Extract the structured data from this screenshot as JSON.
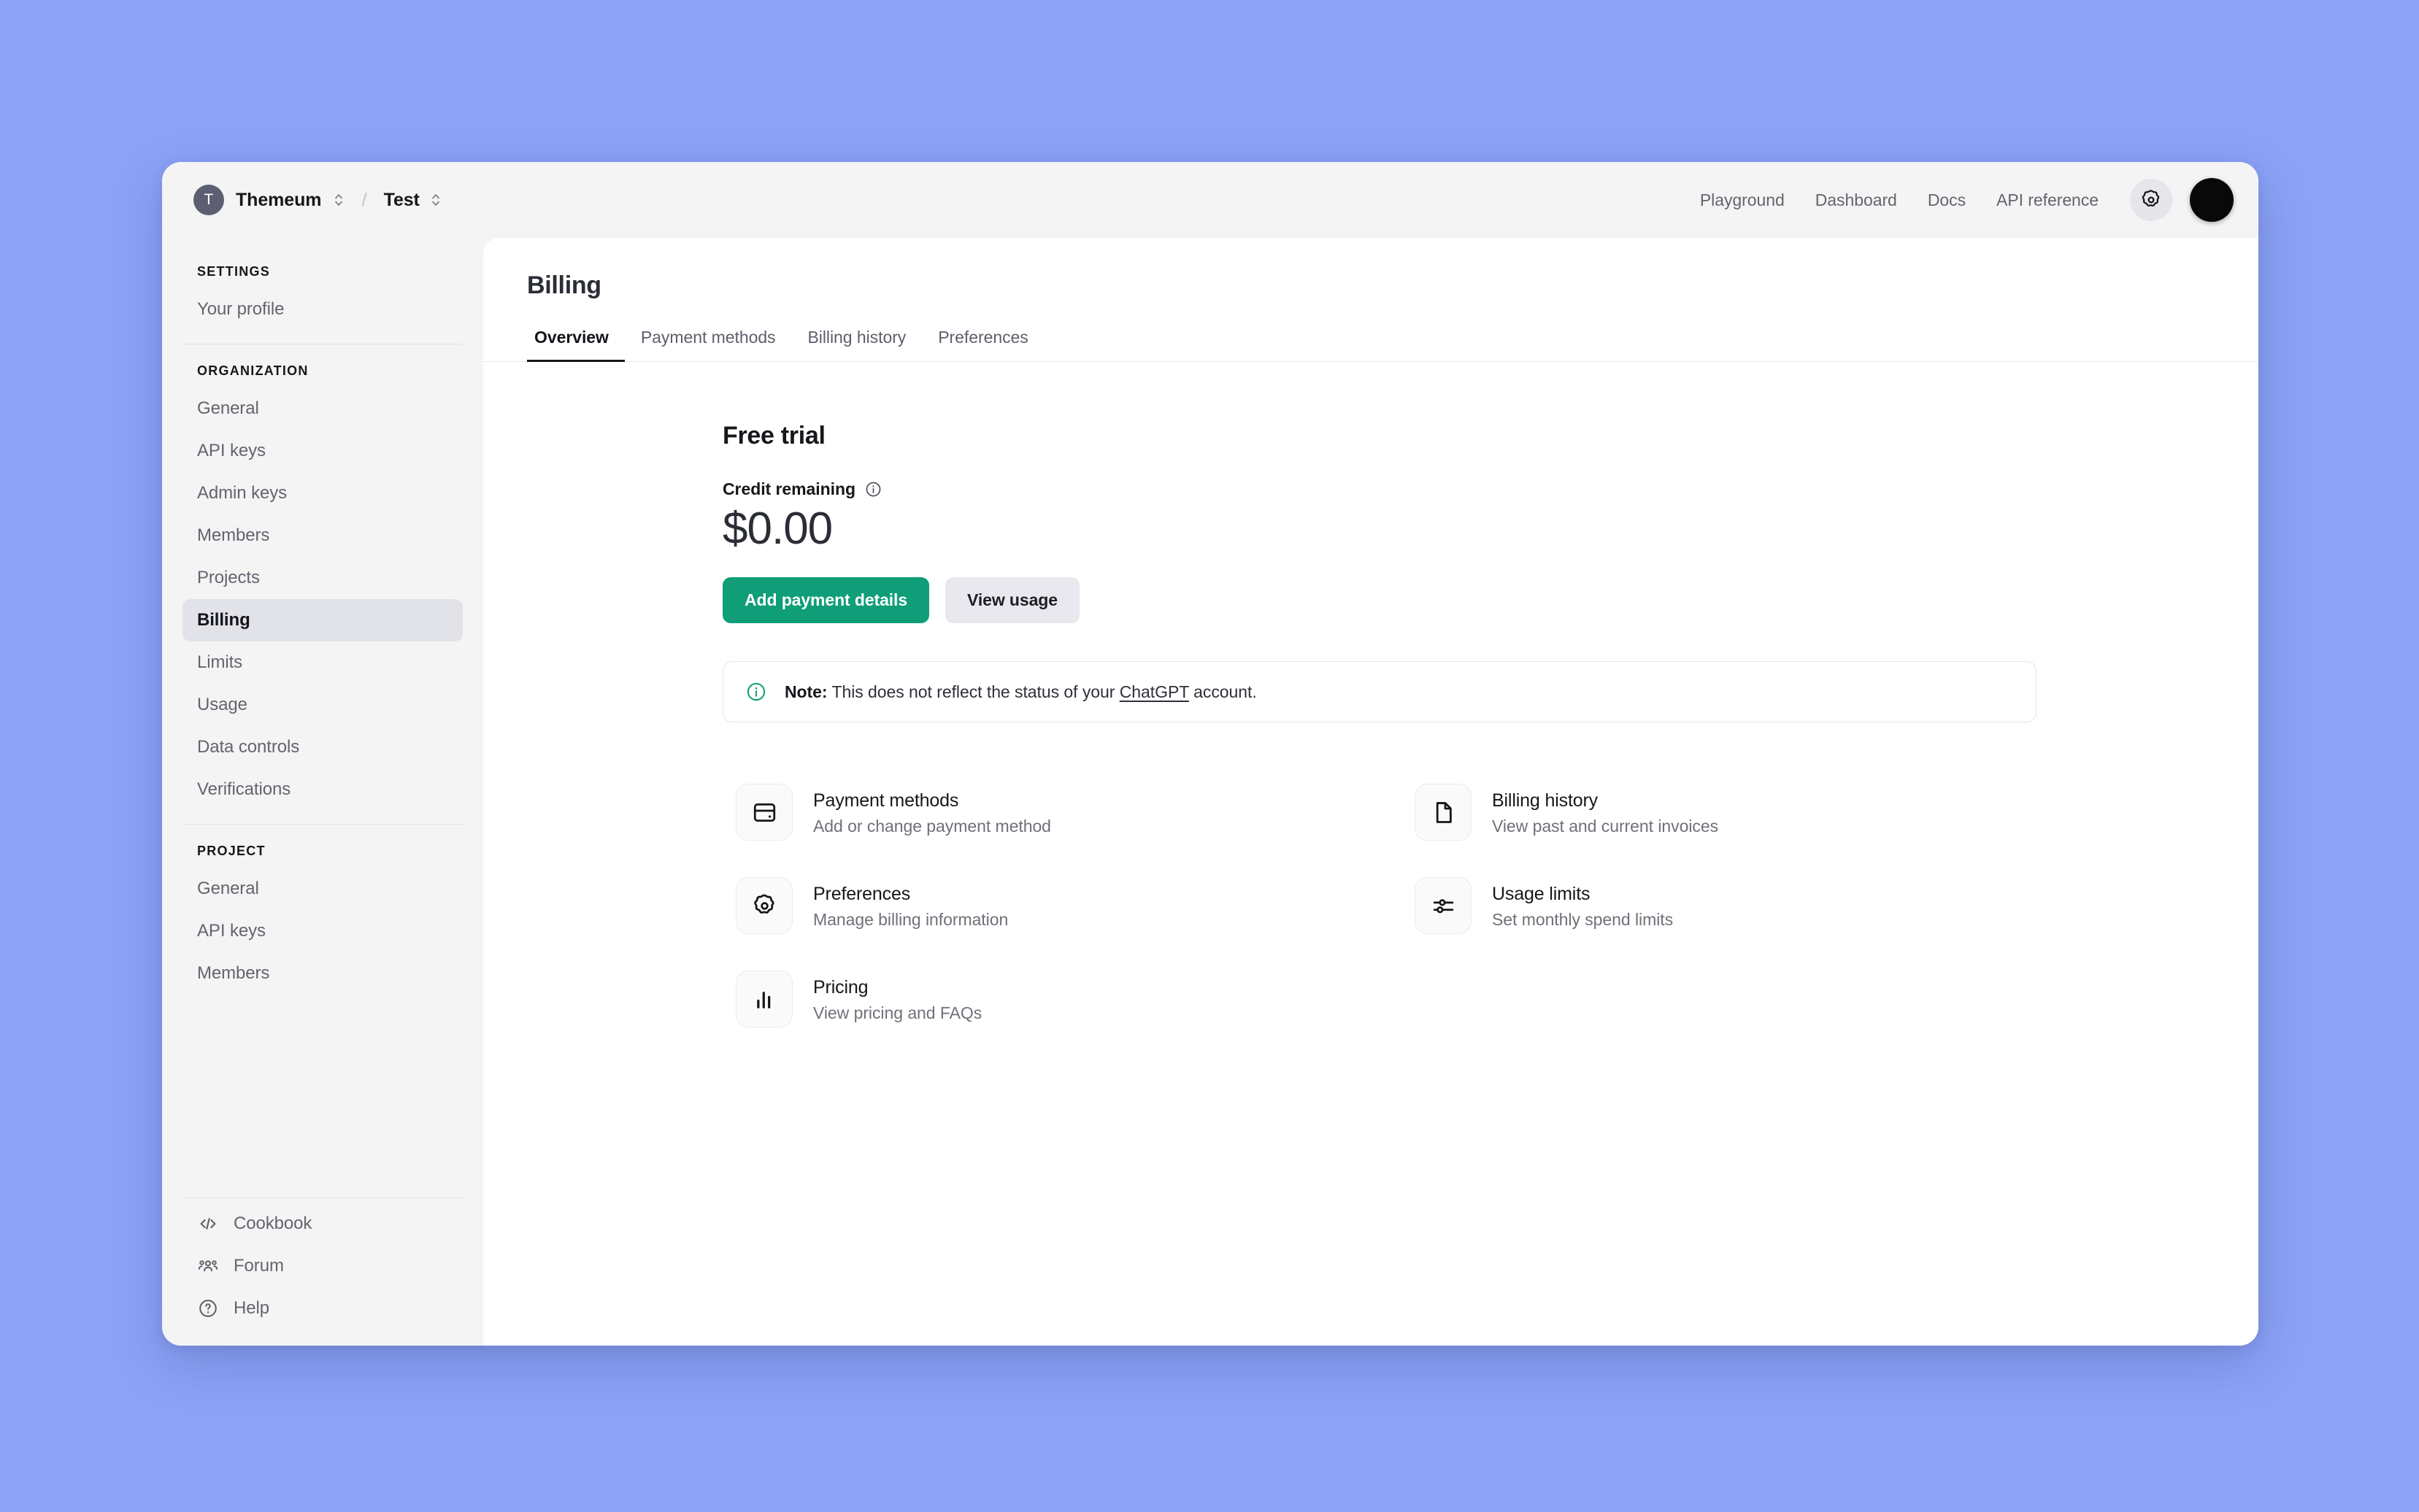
{
  "topbar": {
    "org": {
      "avatar_initial": "T",
      "name": "Themeum",
      "selector_icon": "chevron-up-down-icon"
    },
    "separator": "/",
    "project": {
      "name": "Test",
      "selector_icon": "chevron-up-down-icon"
    },
    "nav_links": [
      "Playground",
      "Dashboard",
      "Docs",
      "API reference"
    ],
    "settings_icon": "gear-icon",
    "avatar_icon": "user-avatar"
  },
  "sidebar": {
    "groups": [
      {
        "label": "SETTINGS",
        "items": [
          {
            "label": "Your profile",
            "active": false
          }
        ]
      },
      {
        "label": "ORGANIZATION",
        "items": [
          {
            "label": "General",
            "active": false
          },
          {
            "label": "API keys",
            "active": false
          },
          {
            "label": "Admin keys",
            "active": false
          },
          {
            "label": "Members",
            "active": false
          },
          {
            "label": "Projects",
            "active": false
          },
          {
            "label": "Billing",
            "active": true
          },
          {
            "label": "Limits",
            "active": false
          },
          {
            "label": "Usage",
            "active": false
          },
          {
            "label": "Data controls",
            "active": false
          },
          {
            "label": "Verifications",
            "active": false
          }
        ]
      },
      {
        "label": "PROJECT",
        "items": [
          {
            "label": "General",
            "active": false
          },
          {
            "label": "API keys",
            "active": false
          },
          {
            "label": "Members",
            "active": false
          }
        ]
      }
    ],
    "bottom_links": [
      {
        "label": "Cookbook",
        "icon": "code-brackets-icon"
      },
      {
        "label": "Forum",
        "icon": "people-group-icon"
      },
      {
        "label": "Help",
        "icon": "question-circle-icon"
      }
    ]
  },
  "main": {
    "page_title": "Billing",
    "tabs": [
      {
        "label": "Overview",
        "active": true
      },
      {
        "label": "Payment methods",
        "active": false
      },
      {
        "label": "Billing history",
        "active": false
      },
      {
        "label": "Preferences",
        "active": false
      }
    ],
    "plan_title": "Free trial",
    "credit_label": "Credit remaining",
    "credit_info_icon": "info-circle-icon",
    "credit_amount": "$0.00",
    "primary_button": "Add payment details",
    "secondary_button": "View usage",
    "note": {
      "icon": "info-circle-icon",
      "bold_prefix": "Note:",
      "text_before": " This does not reflect the status of your ",
      "link_text": "ChatGPT",
      "text_after": " account."
    },
    "tiles": [
      {
        "title": "Payment methods",
        "subtitle": "Add or change payment method",
        "icon": "credit-card-icon"
      },
      {
        "title": "Billing history",
        "subtitle": "View past and current invoices",
        "icon": "document-icon"
      },
      {
        "title": "Preferences",
        "subtitle": "Manage billing information",
        "icon": "gear-icon"
      },
      {
        "title": "Usage limits",
        "subtitle": "Set monthly spend limits",
        "icon": "sliders-icon"
      },
      {
        "title": "Pricing",
        "subtitle": "View pricing and FAQs",
        "icon": "bar-chart-icon"
      }
    ]
  },
  "colors": {
    "page_background": "#8ba2f7",
    "window_background": "#f4f4f4",
    "panel_background": "#ffffff",
    "primary_accent": "#0f9e77",
    "active_sidebar": "#e2e2e9",
    "note_icon": "#0f9e77"
  }
}
